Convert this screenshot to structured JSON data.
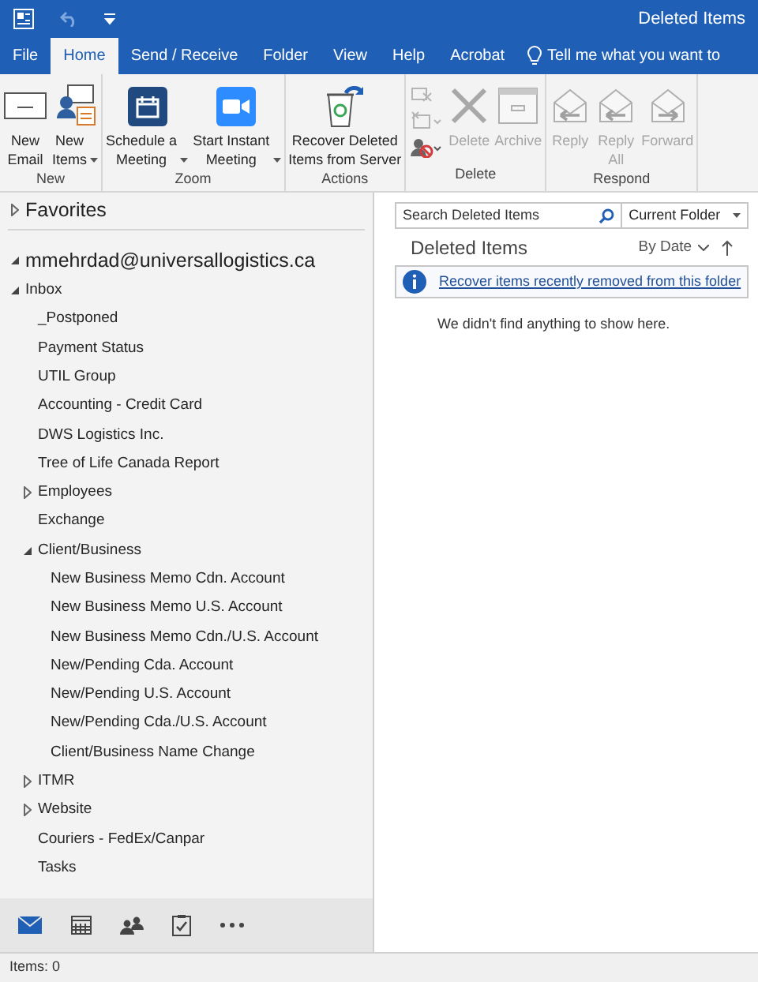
{
  "title_bar": {
    "title": "Deleted Items"
  },
  "ribbon_tabs": [
    {
      "label": "File",
      "selected": false
    },
    {
      "label": "Home",
      "selected": true
    },
    {
      "label": "Send / Receive",
      "selected": false
    },
    {
      "label": "Folder",
      "selected": false
    },
    {
      "label": "View",
      "selected": false
    },
    {
      "label": "Help",
      "selected": false
    },
    {
      "label": "Acrobat",
      "selected": false
    }
  ],
  "tell_me": {
    "placeholder": "Tell me what you want to"
  },
  "ribbon_groups": [
    {
      "label": "New",
      "buttons": [
        {
          "kind": "envelope",
          "label": "New\nEmail",
          "dropdown": false,
          "disabled": false
        },
        {
          "kind": "items",
          "label": "New\nItems",
          "dropdown": true,
          "disabled": false
        }
      ]
    },
    {
      "label": "Zoom",
      "buttons": [
        {
          "kind": "calendar",
          "label": "Schedule a\nMeeting",
          "dropdown": true,
          "disabled": false
        },
        {
          "kind": "video",
          "label": "Start Instant\nMeeting",
          "dropdown": true,
          "disabled": false
        }
      ]
    },
    {
      "label": "Actions",
      "buttons": [
        {
          "kind": "recycle",
          "label": "Recover Deleted\nItems from Server",
          "dropdown": false,
          "disabled": false
        }
      ]
    },
    {
      "label": "Delete",
      "buttons": [
        {
          "kind": "small-stack",
          "disabled": true
        },
        {
          "kind": "x",
          "label": "Delete",
          "dropdown": false,
          "disabled": true
        },
        {
          "kind": "archive",
          "label": "Archive",
          "dropdown": false,
          "disabled": true
        }
      ]
    },
    {
      "label": "Respond",
      "buttons": [
        {
          "kind": "reply",
          "label": "Reply",
          "dropdown": false,
          "disabled": true
        },
        {
          "kind": "reply",
          "label": "Reply\nAll",
          "dropdown": false,
          "disabled": true
        },
        {
          "kind": "forward",
          "label": "Forward",
          "dropdown": false,
          "disabled": true
        }
      ]
    }
  ],
  "favorites": {
    "label": "Favorites",
    "expanded": false
  },
  "account": {
    "label": "mmehrdad@universallogistics.ca",
    "expanded": true,
    "folders": [
      {
        "label": "Inbox",
        "expanded": true,
        "children": [
          {
            "label": "_Postponed"
          },
          {
            "label": "Payment Status"
          },
          {
            "label": "UTIL Group"
          },
          {
            "label": "Accounting - Credit Card"
          },
          {
            "label": "DWS Logistics Inc."
          },
          {
            "label": "Tree of Life Canada Report"
          },
          {
            "label": "Employees",
            "expanded": false
          },
          {
            "label": "Exchange"
          },
          {
            "label": "Client/Business",
            "expanded": true,
            "children": [
              {
                "label": "New Business Memo Cdn. Account"
              },
              {
                "label": "New Business Memo U.S. Account"
              },
              {
                "label": "New Business Memo Cdn./U.S. Account"
              },
              {
                "label": "New/Pending Cda. Account"
              },
              {
                "label": "New/Pending U.S. Account"
              },
              {
                "label": "New/Pending Cda./U.S. Account"
              },
              {
                "label": "Client/Business Name Change"
              }
            ]
          },
          {
            "label": "ITMR",
            "expanded": false
          },
          {
            "label": "Website",
            "expanded": false
          },
          {
            "label": "Couriers - FedEx/Canpar"
          },
          {
            "label": "Tasks"
          }
        ]
      }
    ]
  },
  "nav_bar": [
    {
      "kind": "mail",
      "selected": true
    },
    {
      "kind": "calendar",
      "selected": false
    },
    {
      "kind": "people",
      "selected": false
    },
    {
      "kind": "tasks",
      "selected": false
    },
    {
      "kind": "more",
      "selected": false
    }
  ],
  "search": {
    "placeholder": "Search Deleted Items",
    "scope": "Current Folder"
  },
  "message_list": {
    "folder_title": "Deleted Items",
    "sort": "By Date",
    "info_link": "Recover items recently removed from this folder",
    "empty_text": "We didn't find anything to show here."
  },
  "status_bar": {
    "text": "Items: 0"
  }
}
